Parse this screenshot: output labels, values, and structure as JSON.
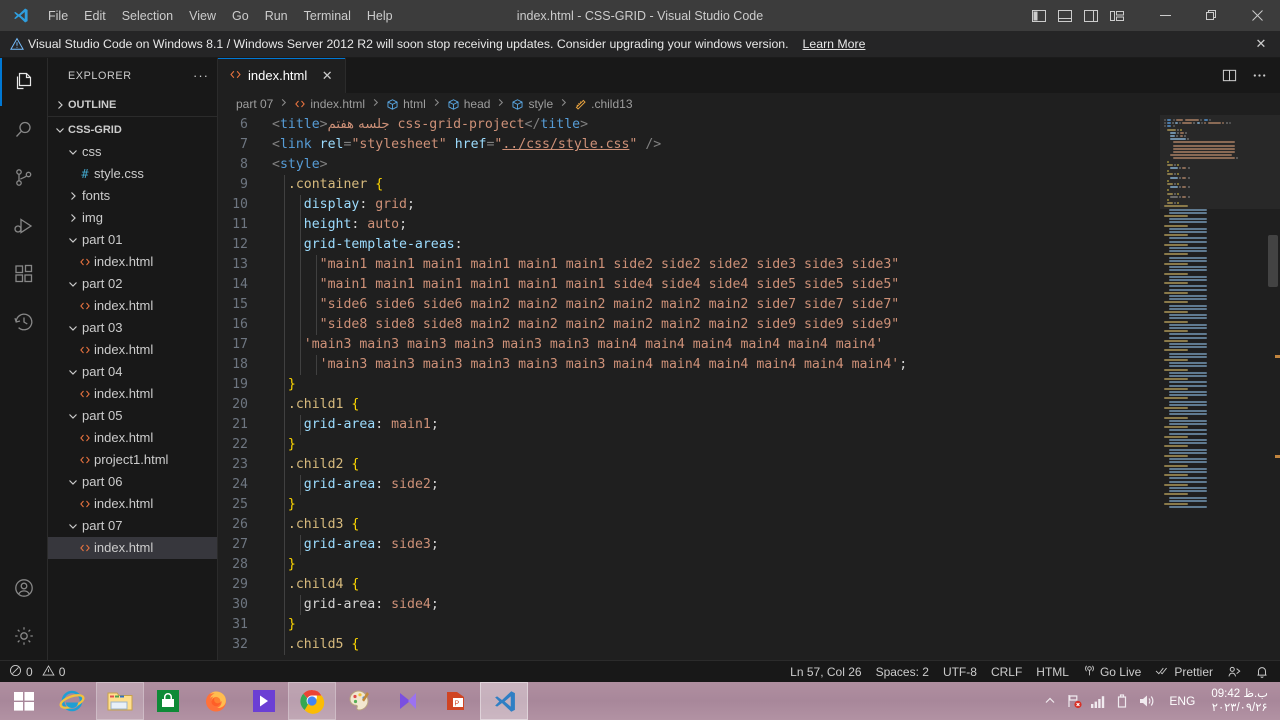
{
  "titlebar": {
    "title": "index.html - CSS-GRID - Visual Studio Code",
    "menu": [
      "File",
      "Edit",
      "Selection",
      "View",
      "Go",
      "Run",
      "Terminal",
      "Help"
    ],
    "layout_icons": [
      "toggle-primary-sidebar-icon",
      "toggle-panel-icon",
      "toggle-secondary-sidebar-icon",
      "customize-layout-icon"
    ],
    "window_controls": [
      "minimize",
      "restore",
      "close"
    ]
  },
  "banner": {
    "text": "Visual Studio Code on Windows 8.1 / Windows Server 2012 R2 will soon stop receiving updates. Consider upgrading your windows version.",
    "link": "Learn More",
    "close": "✕"
  },
  "activitybar": {
    "items": [
      {
        "name": "explorer",
        "icon": "files-icon",
        "active": true
      },
      {
        "name": "search",
        "icon": "search-icon",
        "active": false
      },
      {
        "name": "source-control",
        "icon": "source-control-icon",
        "active": false
      },
      {
        "name": "run-and-debug",
        "icon": "debug-icon",
        "active": false
      },
      {
        "name": "extensions",
        "icon": "extensions-icon",
        "active": false
      },
      {
        "name": "timeline",
        "icon": "history-icon",
        "active": false
      }
    ],
    "bottom": [
      {
        "name": "accounts",
        "icon": "account-icon"
      },
      {
        "name": "manage",
        "icon": "gear-icon"
      }
    ]
  },
  "sidebar": {
    "header": "EXPLORER",
    "more_actions": "···",
    "outline_label": "OUTLINE",
    "root_label": "CSS-GRID",
    "tree": [
      {
        "label": "css",
        "indent": 1,
        "kind": "folder-open",
        "icon": "chevron-down-icon",
        "selected": false
      },
      {
        "label": "style.css",
        "indent": 2,
        "kind": "css-file",
        "icon": "hash-icon",
        "selected": false
      },
      {
        "label": "fonts",
        "indent": 1,
        "kind": "folder",
        "icon": "chevron-right-icon",
        "selected": false
      },
      {
        "label": "img",
        "indent": 1,
        "kind": "folder",
        "icon": "chevron-right-icon",
        "selected": false
      },
      {
        "label": "part 01",
        "indent": 1,
        "kind": "folder-open",
        "icon": "chevron-down-icon",
        "selected": false
      },
      {
        "label": "index.html",
        "indent": 2,
        "kind": "html-file",
        "icon": "html-icon",
        "selected": false
      },
      {
        "label": "part 02",
        "indent": 1,
        "kind": "folder-open",
        "icon": "chevron-down-icon",
        "selected": false
      },
      {
        "label": "index.html",
        "indent": 2,
        "kind": "html-file",
        "icon": "html-icon",
        "selected": false
      },
      {
        "label": "part 03",
        "indent": 1,
        "kind": "folder-open",
        "icon": "chevron-down-icon",
        "selected": false
      },
      {
        "label": "index.html",
        "indent": 2,
        "kind": "html-file",
        "icon": "html-icon",
        "selected": false
      },
      {
        "label": "part 04",
        "indent": 1,
        "kind": "folder-open",
        "icon": "chevron-down-icon",
        "selected": false
      },
      {
        "label": "index.html",
        "indent": 2,
        "kind": "html-file",
        "icon": "html-icon",
        "selected": false
      },
      {
        "label": "part 05",
        "indent": 1,
        "kind": "folder-open",
        "icon": "chevron-down-icon",
        "selected": false
      },
      {
        "label": "index.html",
        "indent": 2,
        "kind": "html-file",
        "icon": "html-icon",
        "selected": false
      },
      {
        "label": "project1.html",
        "indent": 2,
        "kind": "html-file",
        "icon": "html-icon",
        "selected": false
      },
      {
        "label": "part 06",
        "indent": 1,
        "kind": "folder-open",
        "icon": "chevron-down-icon",
        "selected": false
      },
      {
        "label": "index.html",
        "indent": 2,
        "kind": "html-file",
        "icon": "html-icon",
        "selected": false
      },
      {
        "label": "part 07",
        "indent": 1,
        "kind": "folder-open",
        "icon": "chevron-down-icon",
        "selected": false
      },
      {
        "label": "index.html",
        "indent": 2,
        "kind": "html-file",
        "icon": "html-icon",
        "selected": true
      }
    ]
  },
  "editor": {
    "tab": {
      "label": "index.html",
      "icon": "html-icon",
      "close": "✕"
    },
    "tab_actions": [
      "split-editor-icon",
      "more-actions-icon"
    ],
    "breadcrumb": [
      {
        "label": "part 07",
        "icon": ""
      },
      {
        "label": "index.html",
        "icon": "html-icon"
      },
      {
        "label": "html",
        "icon": "symbol-field-icon"
      },
      {
        "label": "head",
        "icon": "symbol-field-icon"
      },
      {
        "label": "style",
        "icon": "symbol-field-icon"
      },
      {
        "label": ".child13",
        "icon": "symbol-ruler-icon"
      }
    ],
    "first_line_number": 6,
    "lines": [
      {
        "n": 6,
        "indent": 0,
        "tokens": [
          {
            "t": "<",
            "c": "punct"
          },
          {
            "t": "title",
            "c": "tag"
          },
          {
            "t": ">",
            "c": "punct"
          },
          {
            "t": "جلسه هفتم",
            "c": "persian"
          },
          {
            "t": " css-grid-project",
            "c": "val"
          },
          {
            "t": "</",
            "c": "punct"
          },
          {
            "t": "title",
            "c": "tag"
          },
          {
            "t": ">",
            "c": "punct"
          }
        ]
      },
      {
        "n": 7,
        "indent": 0,
        "tokens": [
          {
            "t": "<",
            "c": "punct"
          },
          {
            "t": "link",
            "c": "tag"
          },
          {
            "t": " ",
            "c": "plain"
          },
          {
            "t": "rel",
            "c": "attr"
          },
          {
            "t": "=",
            "c": "punct"
          },
          {
            "t": "\"stylesheet\"",
            "c": "str"
          },
          {
            "t": " ",
            "c": "plain"
          },
          {
            "t": "href",
            "c": "attr"
          },
          {
            "t": "=",
            "c": "punct"
          },
          {
            "t": "\"",
            "c": "str"
          },
          {
            "t": "../css/style.css",
            "c": "link"
          },
          {
            "t": "\"",
            "c": "str"
          },
          {
            "t": " ",
            "c": "plain"
          },
          {
            "t": "/>",
            "c": "punct"
          }
        ]
      },
      {
        "n": 8,
        "indent": 0,
        "tokens": [
          {
            "t": "<",
            "c": "punct"
          },
          {
            "t": "style",
            "c": "tag"
          },
          {
            "t": ">",
            "c": "punct"
          }
        ]
      },
      {
        "n": 9,
        "indent": 1,
        "tokens": [
          {
            "t": ".container",
            "c": "sel"
          },
          {
            "t": " ",
            "c": "plain"
          },
          {
            "t": "{",
            "c": "brace"
          }
        ]
      },
      {
        "n": 10,
        "indent": 2,
        "tokens": [
          {
            "t": "display",
            "c": "prop"
          },
          {
            "t": ": ",
            "c": "plain"
          },
          {
            "t": "grid",
            "c": "val"
          },
          {
            "t": ";",
            "c": "plain"
          }
        ]
      },
      {
        "n": 11,
        "indent": 2,
        "tokens": [
          {
            "t": "height",
            "c": "prop"
          },
          {
            "t": ": ",
            "c": "plain"
          },
          {
            "t": "auto",
            "c": "val"
          },
          {
            "t": ";",
            "c": "plain"
          }
        ]
      },
      {
        "n": 12,
        "indent": 2,
        "tokens": [
          {
            "t": "grid-template-areas",
            "c": "prop"
          },
          {
            "t": ":",
            "c": "plain"
          }
        ]
      },
      {
        "n": 13,
        "indent": 3,
        "tokens": [
          {
            "t": "\"main1 main1 main1 main1 main1 main1 side2 side2 side2 side3 side3 side3\"",
            "c": "val"
          }
        ]
      },
      {
        "n": 14,
        "indent": 3,
        "tokens": [
          {
            "t": "\"main1 main1 main1 main1 main1 main1 side4 side4 side4 side5 side5 side5\"",
            "c": "val"
          }
        ]
      },
      {
        "n": 15,
        "indent": 3,
        "tokens": [
          {
            "t": "\"side6 side6 side6 main2 main2 main2 main2 main2 main2 side7 side7 side7\"",
            "c": "val"
          }
        ]
      },
      {
        "n": 16,
        "indent": 3,
        "tokens": [
          {
            "t": "\"side8 side8 side8 main2 main2 main2 main2 main2 main2 side9 side9 side9\"",
            "c": "val"
          }
        ]
      },
      {
        "n": 17,
        "indent": 2,
        "tokens": [
          {
            "t": "'main3 main3 main3 main3 main3 main3 main4 main4 main4 main4 main4 main4'",
            "c": "val"
          }
        ]
      },
      {
        "n": 18,
        "indent": 3,
        "tokens": [
          {
            "t": "'main3 main3 main3 main3 main3 main3 main4 main4 main4 main4 main4 main4'",
            "c": "val"
          },
          {
            "t": ";",
            "c": "plain"
          }
        ]
      },
      {
        "n": 19,
        "indent": 1,
        "tokens": [
          {
            "t": "}",
            "c": "brace"
          }
        ]
      },
      {
        "n": 20,
        "indent": 1,
        "tokens": [
          {
            "t": ".child1",
            "c": "sel"
          },
          {
            "t": " ",
            "c": "plain"
          },
          {
            "t": "{",
            "c": "brace"
          }
        ]
      },
      {
        "n": 21,
        "indent": 2,
        "tokens": [
          {
            "t": "grid-area",
            "c": "prop"
          },
          {
            "t": ": ",
            "c": "plain"
          },
          {
            "t": "main1",
            "c": "val"
          },
          {
            "t": ";",
            "c": "plain"
          }
        ]
      },
      {
        "n": 22,
        "indent": 1,
        "tokens": [
          {
            "t": "}",
            "c": "brace"
          }
        ]
      },
      {
        "n": 23,
        "indent": 1,
        "tokens": [
          {
            "t": ".child2",
            "c": "sel"
          },
          {
            "t": " ",
            "c": "plain"
          },
          {
            "t": "{",
            "c": "brace"
          }
        ]
      },
      {
        "n": 24,
        "indent": 2,
        "tokens": [
          {
            "t": "grid-area",
            "c": "prop"
          },
          {
            "t": ": ",
            "c": "plain"
          },
          {
            "t": "side2",
            "c": "val"
          },
          {
            "t": ";",
            "c": "plain"
          }
        ]
      },
      {
        "n": 25,
        "indent": 1,
        "tokens": [
          {
            "t": "}",
            "c": "brace"
          }
        ]
      },
      {
        "n": 26,
        "indent": 1,
        "tokens": [
          {
            "t": ".child3",
            "c": "sel"
          },
          {
            "t": " ",
            "c": "plain"
          },
          {
            "t": "{",
            "c": "brace"
          }
        ]
      },
      {
        "n": 27,
        "indent": 2,
        "tokens": [
          {
            "t": "grid-area",
            "c": "prop"
          },
          {
            "t": ": ",
            "c": "plain"
          },
          {
            "t": "side3",
            "c": "val"
          },
          {
            "t": ";",
            "c": "plain"
          }
        ]
      },
      {
        "n": 28,
        "indent": 1,
        "tokens": [
          {
            "t": "}",
            "c": "brace"
          }
        ]
      },
      {
        "n": 29,
        "indent": 1,
        "tokens": [
          {
            "t": ".child4",
            "c": "sel"
          },
          {
            "t": " ",
            "c": "plain"
          },
          {
            "t": "{",
            "c": "brace"
          }
        ]
      },
      {
        "n": 30,
        "indent": 2,
        "tokens": [
          {
            "t": "grid-area",
            "c": "plain"
          },
          {
            "t": ": ",
            "c": "plain"
          },
          {
            "t": "side4",
            "c": "val"
          },
          {
            "t": ";",
            "c": "plain"
          }
        ]
      },
      {
        "n": 31,
        "indent": 1,
        "tokens": [
          {
            "t": "}",
            "c": "brace"
          }
        ]
      },
      {
        "n": 32,
        "indent": 1,
        "tokens": [
          {
            "t": ".child5",
            "c": "sel"
          },
          {
            "t": " ",
            "c": "plain"
          },
          {
            "t": "{",
            "c": "brace"
          }
        ]
      }
    ]
  },
  "statusbar": {
    "errors": "0",
    "warnings": "0",
    "position": "Ln 57, Col 26",
    "spaces": "Spaces: 2",
    "encoding": "UTF-8",
    "eol": "CRLF",
    "language": "HTML",
    "golive": "Go Live",
    "prettier": "Prettier",
    "remote_icon": "remote-icon",
    "bell_icon": "bell-icon"
  },
  "taskbar": {
    "start": "start-button",
    "apps": [
      {
        "name": "internet-explorer",
        "state": "normal"
      },
      {
        "name": "file-explorer",
        "state": "open"
      },
      {
        "name": "microsoft-store",
        "state": "normal"
      },
      {
        "name": "firefox",
        "state": "normal"
      },
      {
        "name": "media-player",
        "state": "normal"
      },
      {
        "name": "google-chrome",
        "state": "open"
      },
      {
        "name": "paint",
        "state": "normal"
      },
      {
        "name": "movies-tv",
        "state": "normal"
      },
      {
        "name": "powerpoint",
        "state": "normal"
      },
      {
        "name": "visual-studio-code",
        "state": "active"
      }
    ],
    "tray": {
      "show_hidden": "show-hidden-icons-icon",
      "icons": [
        "network-error-icon",
        "signal-icon",
        "battery-icon",
        "volume-icon"
      ],
      "language": "ENG",
      "time": "09:42 ب.ظ",
      "date": "۲۰۲۳/۰۹/۲۶"
    }
  },
  "colors": {
    "accent": "#0078d4",
    "editor_bg": "#1f1f1f",
    "sidebar_bg": "#181818",
    "titlebar_bg": "#3c3c3c",
    "selection_bg": "#37373d",
    "taskbar_bg": "#b08fa0"
  }
}
